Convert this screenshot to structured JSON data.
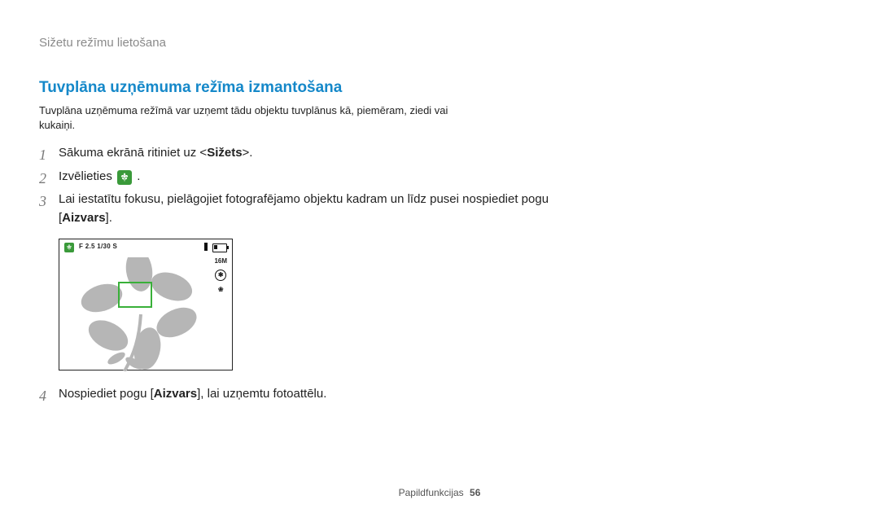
{
  "breadcrumb": "Sižetu režīmu lietošana",
  "section_title": "Tuvplāna uzņēmuma režīma izmantošana",
  "intro": "Tuvplāna uzņēmuma režīmā var uzņemt tādu objektu tuvplānus kā, piemēram, ziedi vai kukaiņi.",
  "steps": {
    "s1_a": "Sākuma ekrānā ritiniet uz <",
    "s1_b": "Sižets",
    "s1_c": ">.",
    "s2_a": "Izvēlieties ",
    "s2_b": ".",
    "s3_a": "Lai iestatītu fokusu, pielāgojiet fotografējamo objektu kadram un līdz pusei nospiediet pogu [",
    "s3_b": "Aizvars",
    "s3_c": "].",
    "s4_a": "Nospiediet pogu [",
    "s4_b": "Aizvars",
    "s4_c": "], lai uzņemtu fotoattēlu."
  },
  "camera": {
    "exposure": "F 2.5 1/30 S",
    "resolution": "16M",
    "flash_glyph": "✱",
    "macro_glyph": "❀"
  },
  "footer": {
    "label": "Papildfunkcijas",
    "page": "56"
  },
  "nums": {
    "n1": "1",
    "n2": "2",
    "n3": "3",
    "n4": "4"
  }
}
